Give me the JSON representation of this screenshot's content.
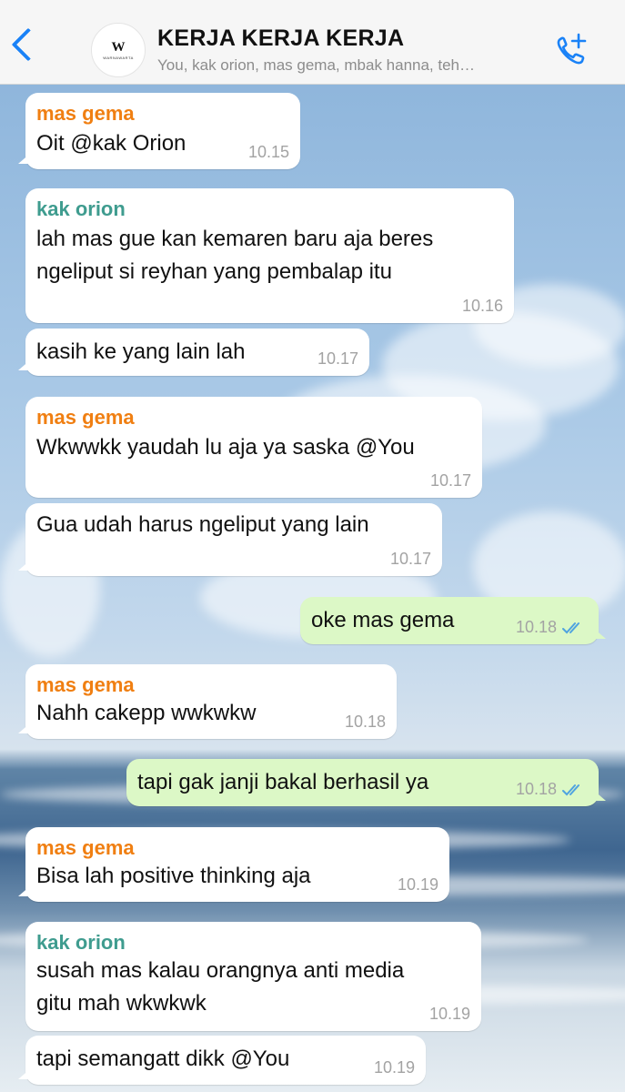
{
  "header": {
    "back_icon": "chevron-left-icon",
    "avatar_mark": "W",
    "avatar_text": "WARNAWARTA",
    "title": "KERJA KERJA KERJA",
    "subtitle": "You, kak orion, mas gema, mbak hanna, teh…",
    "call_icon": "add-call-icon"
  },
  "colors": {
    "accent": "#1a82f7",
    "sender_gema": "#f07f12",
    "sender_orion": "#3f9c8f",
    "outgoing_bubble": "#dcf8c6",
    "incoming_bubble": "#ffffff",
    "read_ticks": "#4fa3e0"
  },
  "messages": [
    {
      "sender": "mas gema",
      "lines": [
        "Oit @kak Orion"
      ],
      "time": "10.15"
    },
    {
      "sender": "kak orion",
      "lines": [
        "lah mas gue kan kemaren baru aja beres",
        "ngeliput si reyhan yang pembalap itu"
      ],
      "time": "10.16"
    },
    {
      "sender": "",
      "lines": [
        "kasih ke yang lain lah"
      ],
      "time": "10.17"
    },
    {
      "sender": "mas gema",
      "lines": [
        "Wkwwkk yaudah lu aja ya saska @You"
      ],
      "time": "10.17"
    },
    {
      "sender": "",
      "lines": [
        "Gua udah harus ngeliput yang lain"
      ],
      "time": "10.17"
    },
    {
      "sender": "You",
      "lines": [
        "oke mas gema"
      ],
      "time": "10.18",
      "status": "read"
    },
    {
      "sender": "mas gema",
      "lines": [
        "Nahh cakepp wwkwkw"
      ],
      "time": "10.18"
    },
    {
      "sender": "You",
      "lines": [
        "tapi gak janji bakal berhasil ya"
      ],
      "time": "10.18",
      "status": "read"
    },
    {
      "sender": "mas gema",
      "lines": [
        "Bisa lah positive thinking aja"
      ],
      "time": "10.19"
    },
    {
      "sender": "kak orion",
      "lines": [
        "susah mas kalau orangnya anti media",
        "gitu mah wkwkwk"
      ],
      "time": "10.19"
    },
    {
      "sender": "",
      "lines": [
        "tapi semangatt dikk @You"
      ],
      "time": "10.19"
    }
  ]
}
